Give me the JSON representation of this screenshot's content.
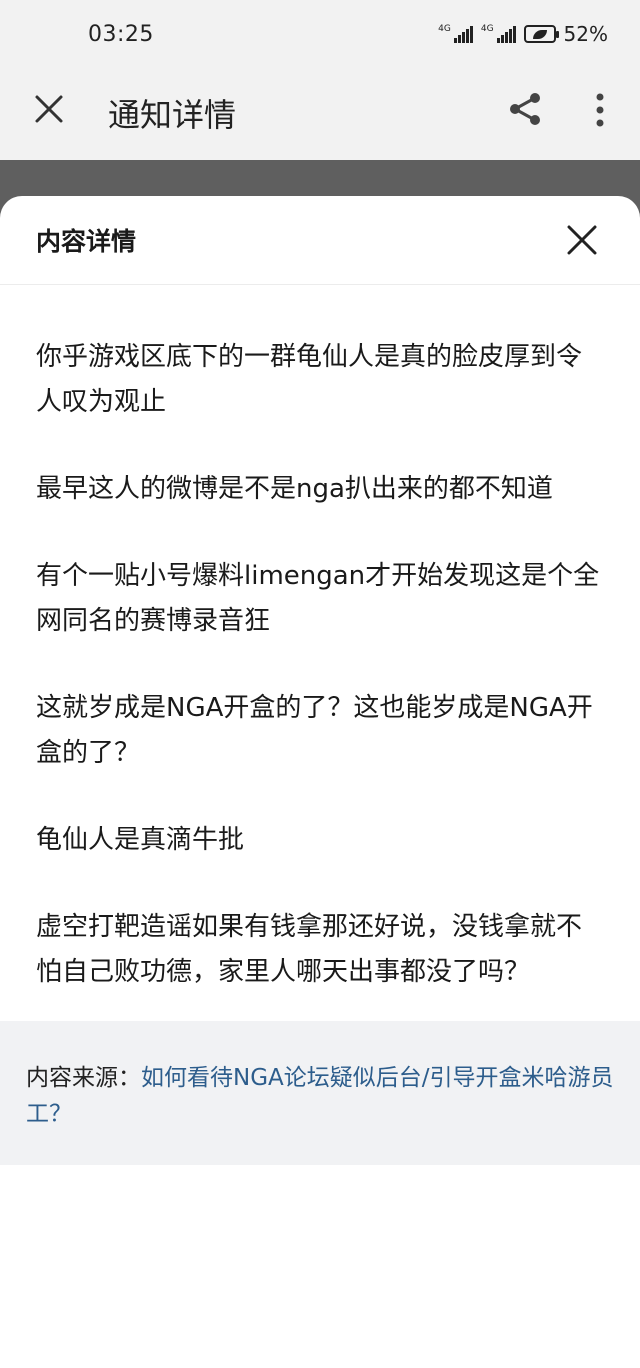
{
  "status_bar": {
    "time": "03:25",
    "signal1_tag": "4G",
    "signal2_tag": "4G",
    "battery_percent": "52%"
  },
  "app_bar": {
    "title": "通知详情",
    "icons": [
      "close-icon",
      "share-icon",
      "more-vert-icon"
    ]
  },
  "sheet": {
    "title": "内容详情",
    "paragraphs": [
      "你乎游戏区底下的一群龟仙人是真的脸皮厚到令人叹为观止",
      "最早这人的微博是不是nga扒出来的都不知道",
      "有个一贴小号爆料limengan才开始发现这是个全网同名的赛博录音狂",
      "这就岁成是NGA开盒的了？这也能岁成是NGA开盒的了？",
      "龟仙人是真滴牛批",
      "虚空打靶造谣如果有钱拿那还好说，没钱拿就不怕自己败功德，家里人哪天出事都没了吗？"
    ],
    "source_label": "内容来源：",
    "source_link": "如何看待NGA论坛疑似后台/引导开盒米哈游员工？"
  },
  "colors": {
    "link": "#2d5d8c",
    "overlay": "#5f5f5f",
    "app_bar_bg": "#f2f2f2",
    "source_bg": "#f1f2f4"
  }
}
